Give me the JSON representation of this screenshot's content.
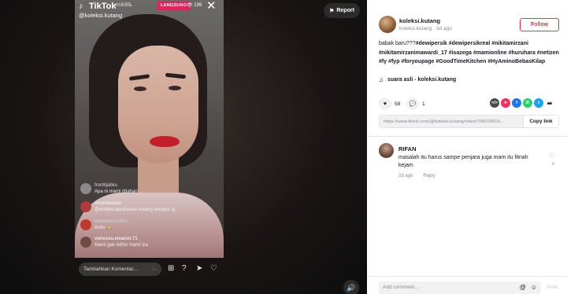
{
  "video": {
    "platform_name": "TikTok",
    "live_user": "esik86",
    "handle": "@koleksi.kutang",
    "live_badge": "LANGSUNG",
    "viewer_count": "199",
    "report_label": "Report",
    "live_comments": [
      {
        "user": "frontlijabku",
        "message": "Apa ni mami ditahan",
        "avatar_color": "#8a8a8a"
      },
      {
        "user": "shzeldenkar",
        "message": "@andikasaputrareal emang kenapa sij",
        "avatar_color": "#b23a3a"
      },
      {
        "user": "romeocruz1415",
        "message": "Amin 🙏",
        "avatar_color": "#c0392b"
      },
      {
        "user": "vanessa.eleanor.71",
        "message": "Mami gak telfon mami iza",
        "avatar_color": "#6d4c41"
      }
    ],
    "live_input_placeholder": "Tambahkan Komentar...",
    "live_input_more": "···"
  },
  "post": {
    "author_name": "koleksi.kutang",
    "author_sub": "koleksi.kutang · 3d ago",
    "follow_label": "Follow",
    "caption_plain": "babak baru???",
    "hashtags": [
      "#dewipersik",
      "#dewipersikreal",
      "#nikitamirzani",
      "#nikitamirzanimawardi_17",
      "#isazega",
      "#mamionline",
      "#huruhara",
      "#netizen",
      "#fy",
      "#fyp",
      "#foryoupage",
      "#GoodTimeKitchen",
      "#HyAminoBebasKilap"
    ],
    "music": "suara asli - koleksi.kutang",
    "likes": "58",
    "comments": "1",
    "share_icons": [
      {
        "name": "embed-icon",
        "label": "</>",
        "color": "#4a4a4a"
      },
      {
        "name": "send-to-friends-icon",
        "label": "➤",
        "color": "#fe2c55"
      },
      {
        "name": "facebook-icon",
        "label": "f",
        "color": "#1877f2"
      },
      {
        "name": "whatsapp-icon",
        "label": "✆",
        "color": "#25d366"
      },
      {
        "name": "twitter-icon",
        "label": "t",
        "color": "#1da1f2"
      },
      {
        "name": "share-arrow-icon",
        "label": "➦",
        "color": "#161823"
      }
    ],
    "link_url": "https://www.tiktok.com/@koleksi.kutang/video/708329919...",
    "copy_link_label": "Copy link"
  },
  "comments_section": {
    "items": [
      {
        "user": "RIFAN",
        "text": "masalah itu harus sampe penjara juga mam itu fitnah kejam",
        "time": "2d ago",
        "reply_label": "Reply",
        "like_count": "0"
      }
    ],
    "add_placeholder": "Add comment...",
    "post_label": "Post"
  }
}
